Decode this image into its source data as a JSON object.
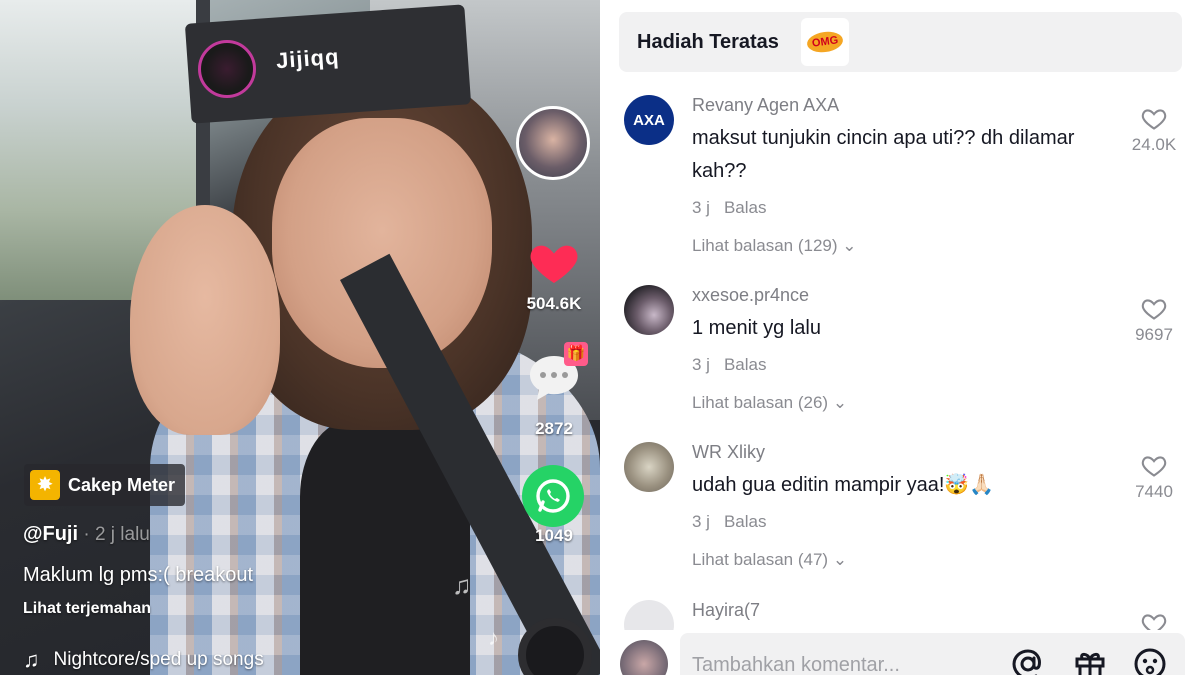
{
  "video": {
    "cap_text": "Jijiqq",
    "like_count": "504.6K",
    "comment_count": "2872",
    "share_count": "1049",
    "badge_label": "Cakep Meter",
    "author": "@Fuji",
    "author_time": " · 2 j lalu",
    "caption": "Maklum lg pms:( breakout",
    "translate_label": "Lihat terjemahan",
    "music": "Nightcore/sped up songs"
  },
  "comments_panel": {
    "gift_title": "Hadiah Teratas",
    "gift_sticker": "OMG",
    "comments": [
      {
        "user": "Revany Agen AXA",
        "avatar_text": "AXA",
        "text": "maksut tunjukin cincin apa uti?? dh dilamar kah??",
        "time": "3 j",
        "reply_label": "Balas",
        "more_replies": "Lihat balasan (129)",
        "likes": "24.0K"
      },
      {
        "user": "xxesoe.pr4nce",
        "text": "1 menit yg lalu",
        "time": "3 j",
        "reply_label": "Balas",
        "more_replies": "Lihat balasan (26)",
        "likes": "9697"
      },
      {
        "user": "WR Xliky",
        "text": "udah gua editin mampir yaa!🤯🙏🏻",
        "time": "3 j",
        "reply_label": "Balas",
        "more_replies": "Lihat balasan (47)",
        "likes": "7440"
      },
      {
        "user": "Hayira(7"
      }
    ],
    "input_placeholder": "Tambahkan komentar..."
  },
  "colors": {
    "like_red": "#fe2c55",
    "whatsapp_green": "#25d366",
    "text_primary": "#161823",
    "text_secondary": "#8a8b91"
  },
  "icons": [
    "heart-icon",
    "comment-bubble-icon",
    "gift-icon",
    "whatsapp-icon",
    "music-note-icon",
    "at-sign-icon",
    "emoji-icon"
  ]
}
